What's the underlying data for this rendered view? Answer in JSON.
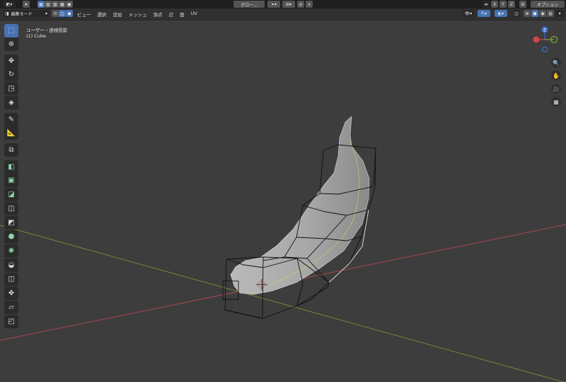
{
  "topbar": {
    "orientation_label": "グロー...",
    "axis_x": "X",
    "axis_y": "Y",
    "axis_z": "Z",
    "options_label": "オプション"
  },
  "header": {
    "mode_label": "編集モード",
    "menus": [
      "ビュー",
      "選択",
      "追加",
      "メッシュ",
      "頂点",
      "辺",
      "面",
      "UV"
    ]
  },
  "viewport": {
    "view_name": "ユーザー・透視投影",
    "object_name": "(1) Cube"
  },
  "gizmo": {
    "axis_z_label": "Z",
    "axis_y_label": "Y",
    "axis_x_label": "X"
  },
  "colors": {
    "accent": "#4772b3",
    "x_axis": "#b3474f",
    "y_axis": "#7c9a3a",
    "gizmo_z": "#3f6fd0",
    "gizmo_x": "#d3444b",
    "gizmo_y": "#86a53b"
  },
  "icons": {
    "toolbar": [
      "select-box-icon",
      "cursor-icon",
      "move-icon",
      "rotate-icon",
      "scale-icon",
      "transform-icon",
      "annotate-icon",
      "measure-icon",
      "add-cube-icon",
      "extrude-icon",
      "inset-icon",
      "bevel-icon",
      "loop-cut-icon",
      "knife-icon",
      "poly-build-icon",
      "spin-icon",
      "smooth-icon",
      "edge-slide-icon",
      "shrink-fatten-icon",
      "shear-icon",
      "rip-icon"
    ],
    "navigation": [
      "zoom-icon",
      "hand-pan-icon",
      "camera-icon",
      "grid-view-icon"
    ]
  }
}
